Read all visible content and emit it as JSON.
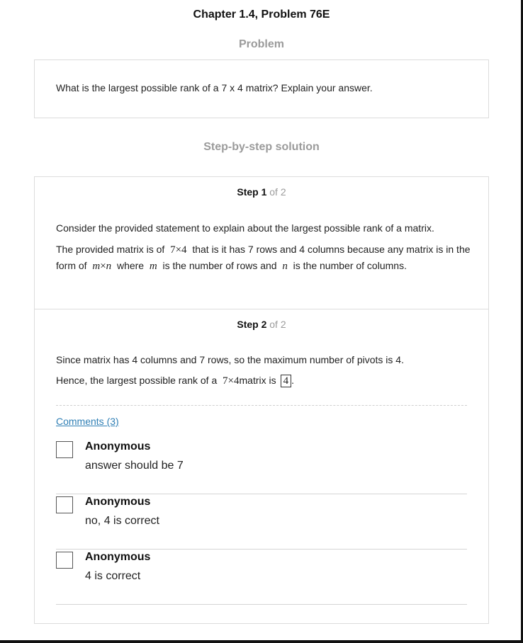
{
  "header": {
    "title": "Chapter 1.4, Problem 76E"
  },
  "problem": {
    "heading": "Problem",
    "text": "What is the largest possible rank of a 7 x 4 matrix? Explain your answer."
  },
  "solution": {
    "heading": "Step-by-step solution",
    "steps": [
      {
        "label": "Step 1",
        "of": "of 2",
        "p1": "Consider the provided statement to explain about the largest possible rank of a matrix.",
        "p2_a": "The provided matrix is of",
        "p2_math1": "7×4",
        "p2_b": "that is it has 7 rows and 4 columns because any matrix is in the form of",
        "p2_math2_m": "m",
        "p2_math2_times": "×",
        "p2_math2_n": "n",
        "p2_c": "where",
        "p2_math3": "m",
        "p2_d": "is the number of rows and",
        "p2_math4": "n",
        "p2_e": "is the number of columns."
      },
      {
        "label": "Step 2",
        "of": "of 2",
        "p1": "Since matrix has 4 columns and 7 rows, so the maximum number of pivots is 4.",
        "p2_a": "Hence, the largest possible rank of a",
        "p2_math": "7×4",
        "p2_b": "matrix is",
        "answer": "4",
        "p2_end": "."
      }
    ]
  },
  "comments": {
    "link_label": "Comments (3)",
    "items": [
      {
        "author": "Anonymous",
        "text": "answer should be 7"
      },
      {
        "author": "Anonymous",
        "text": "no, 4 is correct"
      },
      {
        "author": "Anonymous",
        "text": "4 is correct"
      }
    ]
  }
}
